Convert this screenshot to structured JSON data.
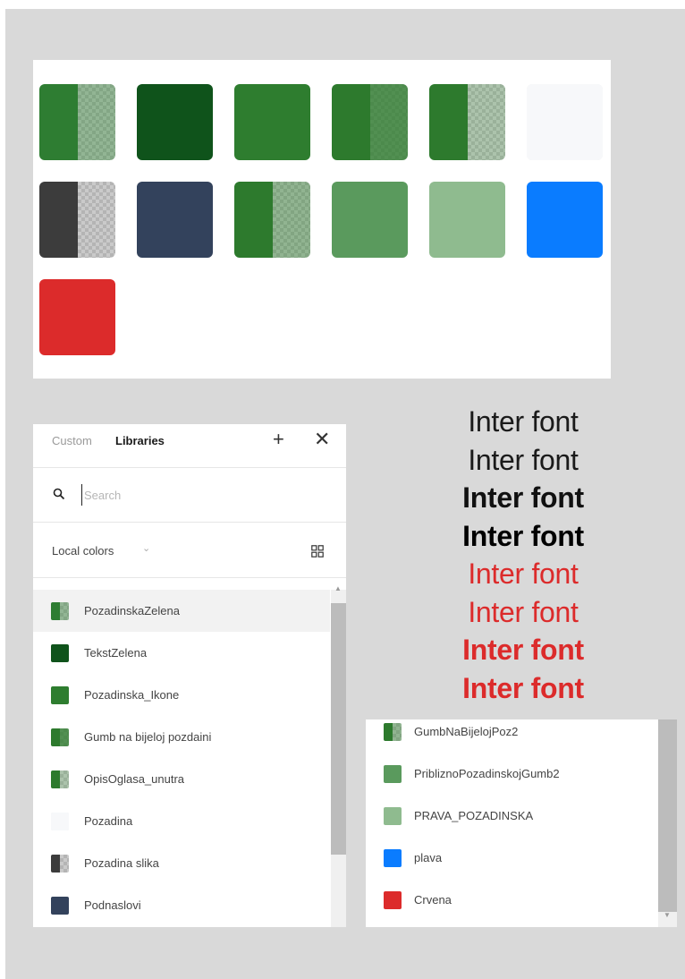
{
  "swatches": [
    {
      "name": "swatch-pozadinska-zelena",
      "left": "#2e7d32",
      "right": "#2e7d32",
      "right_alpha": 0.45
    },
    {
      "name": "swatch-tekst-zelena",
      "left": "#0f531b",
      "right": "#0f531b",
      "right_alpha": 1
    },
    {
      "name": "swatch-pozadinska-ikone",
      "left": "#2e7d2f",
      "right": "#2e7d2f",
      "right_alpha": 1
    },
    {
      "name": "swatch-gumb-na-bijeloj-pozdaini",
      "left": "#2d7a2d",
      "right": "#2d7a2d",
      "right_alpha": 0.8
    },
    {
      "name": "swatch-opis-oglasa-unutra",
      "left": "#2d7a2d",
      "right": "#2d7a2d",
      "right_alpha": 0.3
    },
    {
      "name": "swatch-pozadina",
      "left": "#f7f8fa",
      "right": "#f7f8fa",
      "right_alpha": 1
    },
    {
      "name": "swatch-pozadina-slika",
      "left": "#3c3c3c",
      "right": "#3c3c3c",
      "right_alpha": 0.15
    },
    {
      "name": "swatch-podnaslovi",
      "left": "#33425c",
      "right": "#33425c",
      "right_alpha": 1
    },
    {
      "name": "swatch-gumb-na-bijeloj-poz2",
      "left": "#2d7a2d",
      "right": "#2d7a2d",
      "right_alpha": 0.45
    },
    {
      "name": "swatch-priblizno-pozadinskoj-gumb2",
      "left": "#5a9a5d",
      "right": "#5a9a5d",
      "right_alpha": 1
    },
    {
      "name": "swatch-prava-pozadinska",
      "left": "#8fbb8f",
      "right": "#8fbb8f",
      "right_alpha": 1
    },
    {
      "name": "swatch-plava",
      "left": "#0a7cff",
      "right": "#0a7cff",
      "right_alpha": 1
    },
    {
      "name": "swatch-crvena",
      "left": "#dc2b2b",
      "right": "#dc2b2b",
      "right_alpha": 1
    }
  ],
  "library_panel": {
    "tabs": {
      "custom": "Custom",
      "libraries": "Libraries"
    },
    "add_icon": "+",
    "close_icon": "✕",
    "search": {
      "placeholder": "Search",
      "value": ""
    },
    "filter": {
      "label": "Local colors",
      "chevron": "⌄"
    },
    "items": [
      {
        "label": "PozadinskaZelena",
        "left": "#2e7d32",
        "right": "#2e7d32",
        "right_alpha": 0.45,
        "active": true
      },
      {
        "label": "TekstZelena",
        "left": "#0f531b",
        "right": "#0f531b",
        "right_alpha": 1,
        "active": false
      },
      {
        "label": "Pozadinska_Ikone",
        "left": "#2e7d2f",
        "right": "#2e7d2f",
        "right_alpha": 1,
        "active": false
      },
      {
        "label": "Gumb na bijeloj pozdaini",
        "left": "#2d7a2d",
        "right": "#2d7a2d",
        "right_alpha": 0.8,
        "active": false
      },
      {
        "label": "OpisOglasa_unutra",
        "left": "#2d7a2d",
        "right": "#2d7a2d",
        "right_alpha": 0.3,
        "active": false
      },
      {
        "label": "Pozadina",
        "left": "#f7f8fa",
        "right": "#f7f8fa",
        "right_alpha": 1,
        "active": false
      },
      {
        "label": "Pozadina slika",
        "left": "#3c3c3c",
        "right": "#3c3c3c",
        "right_alpha": 0.15,
        "active": false
      },
      {
        "label": "Podnaslovi",
        "left": "#33425c",
        "right": "#33425c",
        "right_alpha": 1,
        "active": false
      }
    ]
  },
  "library_panel_2": {
    "items": [
      {
        "label": "GumbNaBijelojPoz2",
        "left": "#2d7a2d",
        "right": "#2d7a2d",
        "right_alpha": 0.45
      },
      {
        "label": "PribliznoPozadinskojGumb2",
        "left": "#5a9a5d",
        "right": "#5a9a5d",
        "right_alpha": 1
      },
      {
        "label": "PRAVA_POZADINSKA",
        "left": "#8fbb8f",
        "right": "#8fbb8f",
        "right_alpha": 1
      },
      {
        "label": "plava",
        "left": "#0a7cff",
        "right": "#0a7cff",
        "right_alpha": 1
      },
      {
        "label": "Crvena",
        "left": "#dc2b2b",
        "right": "#dc2b2b",
        "right_alpha": 1
      }
    ]
  },
  "font_samples": [
    {
      "text": "Inter font",
      "color": "#1a1a1a",
      "weight": "w400"
    },
    {
      "text": "Inter font",
      "color": "#1a1a1a",
      "weight": "w500"
    },
    {
      "text": "Inter font",
      "color": "#111111",
      "weight": "w600"
    },
    {
      "text": "Inter font",
      "color": "#000000",
      "weight": "w700"
    },
    {
      "text": "Inter font",
      "color": "#dc2b2b",
      "weight": "w400"
    },
    {
      "text": "Inter font",
      "color": "#dc2b2b",
      "weight": "w500"
    },
    {
      "text": "Inter font",
      "color": "#dc2b2b",
      "weight": "w600"
    },
    {
      "text": "Inter font",
      "color": "#dc2b2b",
      "weight": "w700"
    }
  ]
}
